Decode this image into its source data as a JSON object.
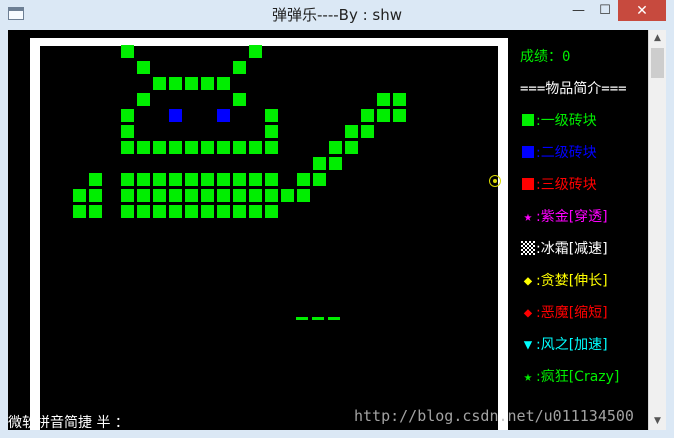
{
  "window": {
    "title": "弹弹乐----By : shw",
    "min_symbol": "—",
    "max_symbol": "☐",
    "close_symbol": "✕"
  },
  "scrollbar": {
    "up_symbol": "▲",
    "down_symbol": "▼"
  },
  "panel": {
    "score_label": "成绩：",
    "score_value": "0",
    "header": "===物品简介===",
    "items": [
      {
        "text": ":一级砖块",
        "color": "#00ee00",
        "icon": "green-square-icon"
      },
      {
        "text": ":二级砖块",
        "color": "#0000ff",
        "icon": "blue-square-icon"
      },
      {
        "text": ":三级砖块",
        "color": "#ff0000",
        "icon": "red-square-icon"
      },
      {
        "sym": "★",
        "text": ":紫金[穿透]",
        "color": "#ff00ff",
        "icon": "star-icon"
      },
      {
        "text": ":冰霜[减速]",
        "color": "#ffffff",
        "icon": "checker-icon"
      },
      {
        "sym": "◆",
        "text": ":贪婪[伸长]",
        "color": "#ffff00",
        "icon": "diamond-icon"
      },
      {
        "sym": "◆",
        "text": ":恶魔[缩短]",
        "color": "#ff0000",
        "icon": "diamond-icon"
      },
      {
        "sym": "▼",
        "text": ":风之[加速]",
        "color": "#00ffff",
        "icon": "triangle-down-icon"
      },
      {
        "sym": "★",
        "text": ":疯狂[Crazy]",
        "color": "#00ee00",
        "icon": "star-icon"
      }
    ]
  },
  "ime_status": "微软拼音简捷 半 ：",
  "watermark": "http://blog.csdn.net/u011134500",
  "colors": {
    "brick_green": "#00ee00",
    "brick_blue": "#0000ff",
    "ball": "#d8d800"
  }
}
